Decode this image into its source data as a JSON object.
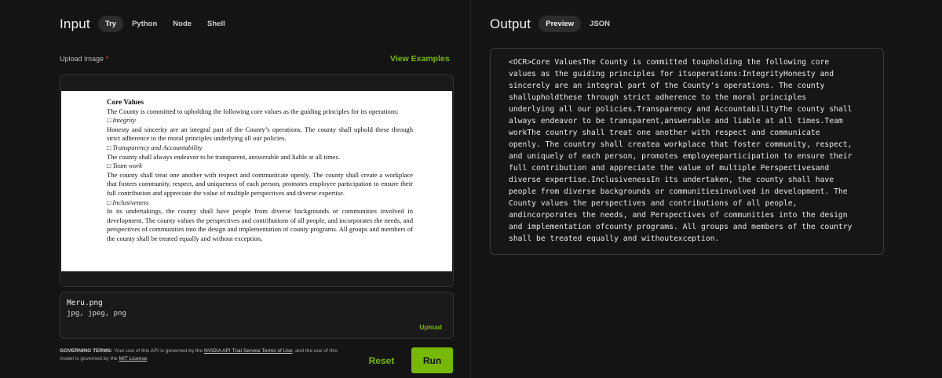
{
  "input": {
    "title": "Input",
    "tabs": [
      "Try",
      "Python",
      "Node",
      "Shell"
    ],
    "upload_label": "Upload Image",
    "required_mark": "*",
    "view_examples": "View Examples",
    "document": {
      "title": "Core Values",
      "intro": "The County is committed to upholding the following core values as the guiding principles for its operations:",
      "sections": [
        {
          "heading": "□ Integrity",
          "body": "Honesty and sincerity are an integral part of the County’s operations. The county shall uphold these through strict adherence to the moral principles underlying all our policies."
        },
        {
          "heading": "□ Transparency and Accountability",
          "body": "The county shall always endeavor to be transparent, answerable and liable at all times."
        },
        {
          "heading": "□ Team work",
          "body": "The county shall treat one another with respect and communicate openly. The county shall create a workplace that fosters community, respect, and uniqueness of each person, promotes employee participation to ensure their full contribution and appreciate the value of multiple perspectives and diverse expertise."
        },
        {
          "heading": "□ Inclusiveness",
          "body": "In its undertakings, the county shall have people from diverse backgrounds or communities involved in development. The county values the perspectives and contributions of all people, and incorporates the needs, and perspectives of communities into the design and implementation of county programs. All groups and members of the county shall be treated equally and without exception."
        }
      ]
    },
    "file": {
      "name": "Meru.png",
      "types": "jpg, jpeg, png",
      "upload_label": "Upload"
    },
    "terms": {
      "label": "GOVERNING TERMS:",
      "text1": "Your use of this API is governed by the",
      "link1": "NVIDIA API Trial Service Terms of Use",
      "text2": "; and the use of this model is governed by the",
      "link2": "MIT License",
      "text3": "."
    },
    "reset_label": "Reset",
    "run_label": "Run"
  },
  "output": {
    "title": "Output",
    "tabs": [
      "Preview",
      "JSON"
    ],
    "text": "<OCR>Core ValuesThe County is committed toupholding the following core\nvalues as the guiding principles for itsoperations:IntegrityHonesty and\nsincerely are an integral part of the County's operations. The county\nshallupholdthese through strict adherence to the moral principles\nunderlying all our policies.Transparency and AccountabilityThe county shall\nalways endeavor to be transparent,answerable and liable at all times.Team\nworkThe country shall treat one another with respect and communicate\nopenly. The country shall createa workplace that foster community, respect,\nand uniquely of each person, promotes employeeparticipation to ensure their\nfull contribution and appreciate the value of multiple Perspectivesand\ndiverse expertise.InclusivenessIn its undertaken, the county shall have\npeople from diverse backgrounds or communitiesinvolved in development. The\nCounty values the perspectives and contributions of all people,\nandincorporates the needs, and Perspectives of communities into the design\nand implementation ofcounty programs. All groups and members of the country\nshall be treated equally and withoutexception."
  },
  "colors": {
    "accent": "#76b900",
    "background": "#141414",
    "required": "#e05050"
  }
}
